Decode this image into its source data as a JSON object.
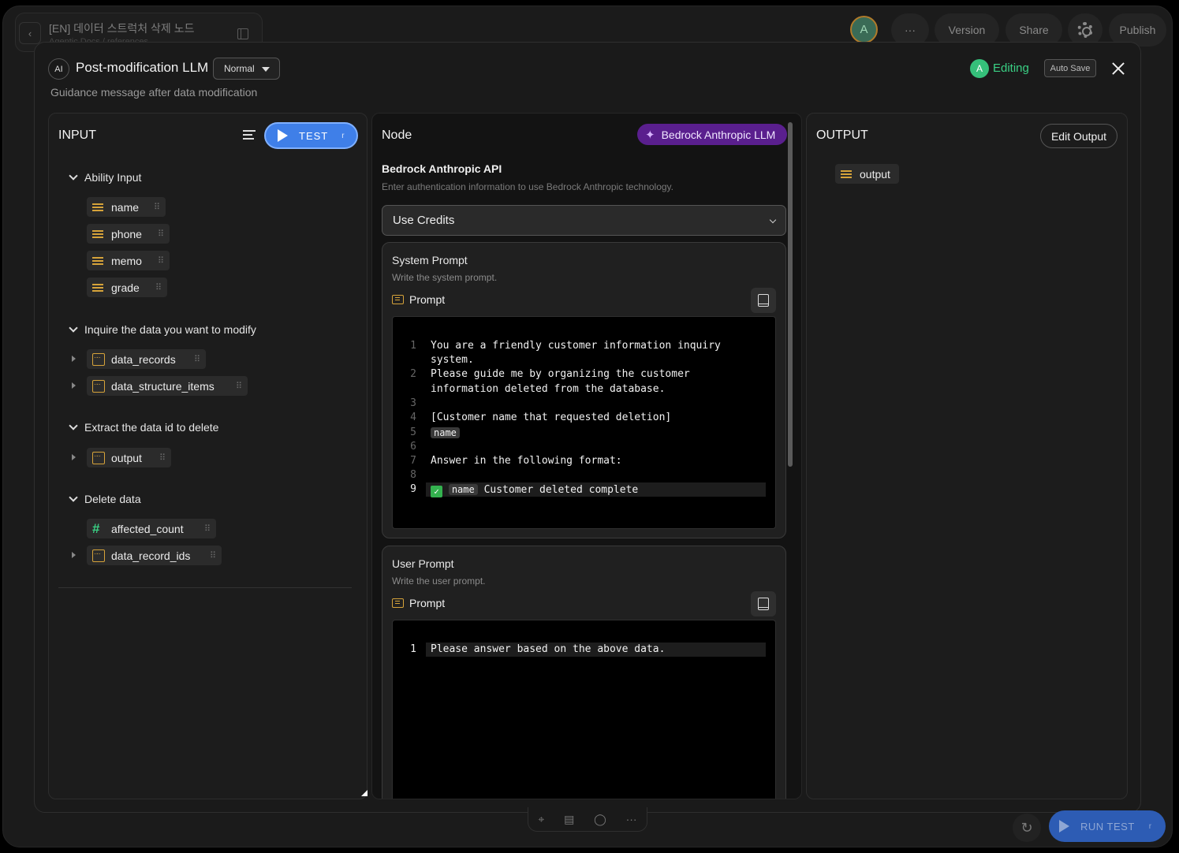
{
  "topbar": {
    "project_title": "[EN] 데이터 스트럭처 삭제 노드",
    "project_subtitle": "Agentic Docs / references",
    "avatar_letter": "A",
    "more_label": "···",
    "version_label": "Version",
    "share_label": "Share",
    "publish_label": "Publish"
  },
  "modal": {
    "ai_badge": "AI",
    "title": "Post-modification LLM",
    "mode": "Normal",
    "description": "Guidance message after data modification",
    "editor_avatar": "A",
    "editing_label": "Editing",
    "autosave_label": "Auto Save"
  },
  "input": {
    "title": "INPUT",
    "test_label": "TEST",
    "test_shortcut": "r",
    "groups": [
      {
        "label": "Ability Input",
        "items": [
          {
            "name": "name",
            "type": "text"
          },
          {
            "name": "phone",
            "type": "text"
          },
          {
            "name": "memo",
            "type": "text"
          },
          {
            "name": "grade",
            "type": "text"
          }
        ]
      },
      {
        "label": "Inquire the data you want to modify",
        "items": [
          {
            "name": "data_records",
            "type": "array"
          },
          {
            "name": "data_structure_items",
            "type": "array"
          }
        ]
      },
      {
        "label": "Extract the data id to delete",
        "items": [
          {
            "name": "output",
            "type": "array"
          }
        ]
      },
      {
        "label": "Delete data",
        "items": [
          {
            "name": "affected_count",
            "type": "number"
          },
          {
            "name": "data_record_ids",
            "type": "array"
          }
        ]
      }
    ]
  },
  "node": {
    "title": "Node",
    "provider_badge": "Bedrock Anthropic LLM",
    "api_title": "Bedrock Anthropic API",
    "api_desc": "Enter authentication information to use Bedrock Anthropic technology.",
    "credentials": "Use Credits",
    "system": {
      "title": "System Prompt",
      "desc": "Write the system prompt.",
      "prompt_label": "Prompt",
      "lines": [
        "You are a friendly customer information inquiry",
        "system.",
        "Please guide me by organizing the customer",
        "information deleted from the database.",
        "",
        "[Customer name that requested deletion]",
        "name",
        "",
        "Answer in the following format:",
        "",
        "Customer deleted complete"
      ],
      "line_numbers": [
        "1",
        "2",
        "3",
        "4",
        "5",
        "6",
        "7",
        "8",
        "9"
      ],
      "check_mark": "✓",
      "token": "name"
    },
    "user": {
      "title": "User Prompt",
      "desc": "Write the user prompt.",
      "prompt_label": "Prompt",
      "line_numbers": [
        "1"
      ],
      "lines": [
        "Please answer based on the above data."
      ]
    }
  },
  "output": {
    "title": "OUTPUT",
    "edit_label": "Edit Output",
    "items": [
      {
        "name": "output",
        "type": "text"
      }
    ]
  },
  "bottom": {
    "run_test_label": "RUN TEST",
    "run_test_shortcut": "r"
  }
}
